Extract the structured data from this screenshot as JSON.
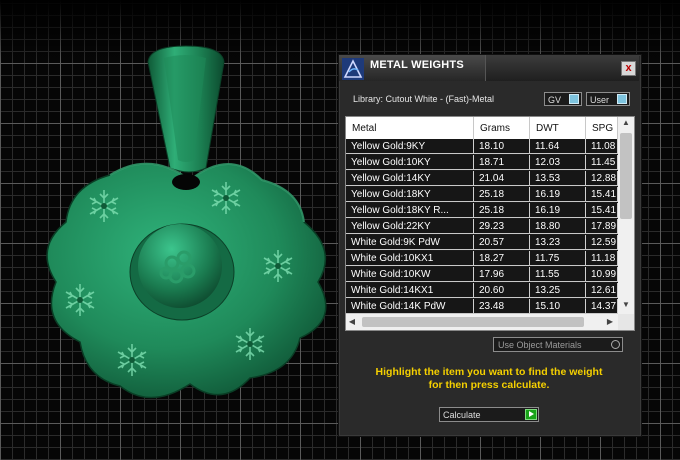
{
  "panel": {
    "title": "METAL WEIGHTS",
    "close_label": "x",
    "library_label": "Library: Cutout White - (Fast)-Metal",
    "gv_label": "GV",
    "user_label": "User",
    "table": {
      "columns": [
        "Metal",
        "Grams",
        "DWT",
        "SPG"
      ],
      "rows": [
        [
          "Yellow Gold:9KY",
          "18.10",
          "11.64",
          "11.08"
        ],
        [
          "Yellow Gold:10KY",
          "18.71",
          "12.03",
          "11.45"
        ],
        [
          "Yellow Gold:14KY",
          "21.04",
          "13.53",
          "12.88"
        ],
        [
          "Yellow Gold:18KY",
          "25.18",
          "16.19",
          "15.41"
        ],
        [
          "Yellow Gold:18KY R...",
          "25.18",
          "16.19",
          "15.41"
        ],
        [
          "Yellow Gold:22KY",
          "29.23",
          "18.80",
          "17.89"
        ],
        [
          "White Gold:9K PdW",
          "20.57",
          "13.23",
          "12.59"
        ],
        [
          "White Gold:10KX1",
          "18.27",
          "11.75",
          "11.18"
        ],
        [
          "White Gold:10KW",
          "17.96",
          "11.55",
          "10.99"
        ],
        [
          "White Gold:14KX1",
          "20.60",
          "13.25",
          "12.61"
        ],
        [
          "White Gold:14K PdW",
          "23.48",
          "15.10",
          "14.37"
        ]
      ]
    },
    "use_object_materials_label": "Use Object Materials",
    "hint_line1": "Highlight the item you want to find the weight",
    "hint_line2": "for then press calculate.",
    "calculate_label": "Calculate"
  },
  "colors": {
    "pendant_green": "#1f8a5a",
    "hint_yellow": "#f5d000",
    "grid_line": "#5a5a5a"
  }
}
